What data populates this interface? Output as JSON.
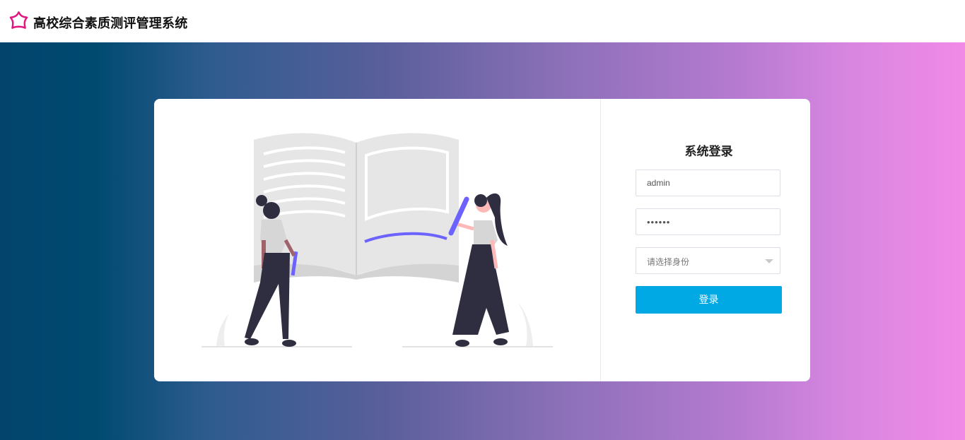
{
  "app": {
    "title": "高校综合素质测评管理系统",
    "logo_icon": "flower-icon",
    "logo_color": "#e0157f"
  },
  "login": {
    "title": "系统登录",
    "username_value": "admin",
    "password_value": "••••••",
    "role_placeholder": "请选择身份",
    "submit_label": "登录"
  },
  "theme": {
    "gradient_start": "#02446c",
    "gradient_end": "#f18ae7",
    "button_color": "#00a9e3",
    "accent_purple": "#6c63ff"
  }
}
